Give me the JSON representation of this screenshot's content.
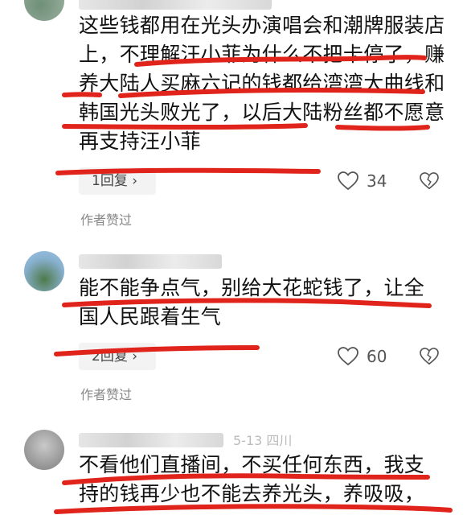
{
  "comments": [
    {
      "text": "这些钱都用在光头办演唱会和潮牌服装店上，不理解汪小菲为什么不把卡停了，赚养大陆人买麻六记的钱都给湾湾大曲线和韩国光头败光了，以后大陆粉丝都不愿意再支持汪小菲",
      "reply_label": "1回复 ›",
      "like_count": "34",
      "author_liked": "作者赞过"
    },
    {
      "text": "能不能争点气，别给大花蛇钱了，让全国人民跟着生气",
      "reply_label": "2回复 ›",
      "like_count": "60",
      "author_liked": "作者赞过"
    },
    {
      "meta_date": "5-13 四川",
      "text": "不看他们直播间，不买任何东西，我支持的钱再少也不能去养光头，养吸吸，"
    }
  ],
  "colors": {
    "annotation_red": "#e0241b",
    "text": "#111111",
    "muted": "#888888"
  },
  "icons": [
    "heart-icon",
    "broken-heart-icon"
  ]
}
